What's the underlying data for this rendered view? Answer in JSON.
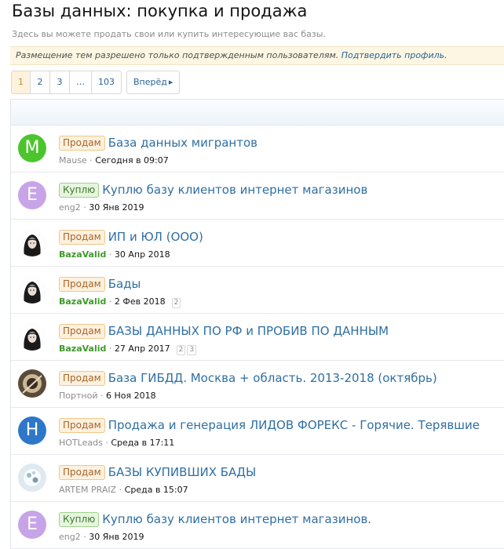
{
  "header": {
    "title": "Базы данных: покупка и продажа",
    "description": "Здесь вы можете продать свои или купить интересующие вас базы."
  },
  "notice": {
    "text": "Размещение тем разрешено только подтвержденным пользователям.",
    "link": "Подтвердить профиль."
  },
  "pagination": {
    "pages": [
      "1",
      "2",
      "3",
      "…",
      "103"
    ],
    "current": "1",
    "next_label": "Вперёд"
  },
  "colors": {
    "link": "#2f6fa3",
    "valid_user": "#3f9a2a",
    "notice_bg": "#fcf6e3"
  },
  "threads": [
    {
      "prefix": "Продам",
      "prefix_type": "sell",
      "title": "База данных мигрантов",
      "author": "Mause",
      "date": "Сегодня в 09:07",
      "avatar": {
        "kind": "letter",
        "letter": "M",
        "color": "#4cc52d"
      },
      "pages": []
    },
    {
      "prefix": "Куплю",
      "prefix_type": "buy",
      "title": "Куплю базу клиентов интернет магазинов",
      "author": "eng2",
      "date": "30 Янв 2019",
      "avatar": {
        "kind": "letter",
        "letter": "E",
        "color": "#c7a3e8"
      },
      "pages": []
    },
    {
      "prefix": "Продам",
      "prefix_type": "sell",
      "title": "ИП и ЮЛ (ООО)",
      "author": "BazaValid",
      "author_valid": true,
      "date": "30 Апр 2018",
      "avatar": {
        "kind": "photo-woman"
      },
      "pages": []
    },
    {
      "prefix": "Продам",
      "prefix_type": "sell",
      "title": "Бады",
      "author": "BazaValid",
      "author_valid": true,
      "date": "2 Фев 2018",
      "avatar": {
        "kind": "photo-woman"
      },
      "pages": [
        "2"
      ]
    },
    {
      "prefix": "Продам",
      "prefix_type": "sell",
      "title": "БАЗЫ ДАННЫХ ПО РФ и ПРОБИВ ПО ДАННЫМ",
      "author": "BazaValid",
      "author_valid": true,
      "date": "27 Апр 2017",
      "avatar": {
        "kind": "photo-woman"
      },
      "pages": [
        "2",
        "3"
      ]
    },
    {
      "prefix": "Продам",
      "prefix_type": "sell",
      "title": "База ГИБДД. Москва + область. 2013-2018 (октябрь)",
      "author": "Портной",
      "date": "6 Ноя 2018",
      "avatar": {
        "kind": "photo-dark"
      },
      "pages": []
    },
    {
      "prefix": "Продам",
      "prefix_type": "sell",
      "title": "Продажа и генерация ЛИДОВ ФОРЕКС - Горячие. Терявшие",
      "author": "HOTLeads",
      "date": "Среда в 17:11",
      "avatar": {
        "kind": "letter",
        "letter": "H",
        "color": "#2e77c8"
      },
      "pages": []
    },
    {
      "prefix": "Продам",
      "prefix_type": "sell",
      "title": "БАЗЫ КУПИВШИХ БАДЫ",
      "author": "ARTEM PRAIZ",
      "date": "Среда в 15:07",
      "avatar": {
        "kind": "photo-light"
      },
      "pages": []
    },
    {
      "prefix": "Куплю",
      "prefix_type": "buy",
      "title": "Куплю базу клиентов интернет магазинов.",
      "author": "eng2",
      "date": "30 Янв 2019",
      "avatar": {
        "kind": "letter",
        "letter": "E",
        "color": "#c7a3e8"
      },
      "pages": []
    }
  ]
}
